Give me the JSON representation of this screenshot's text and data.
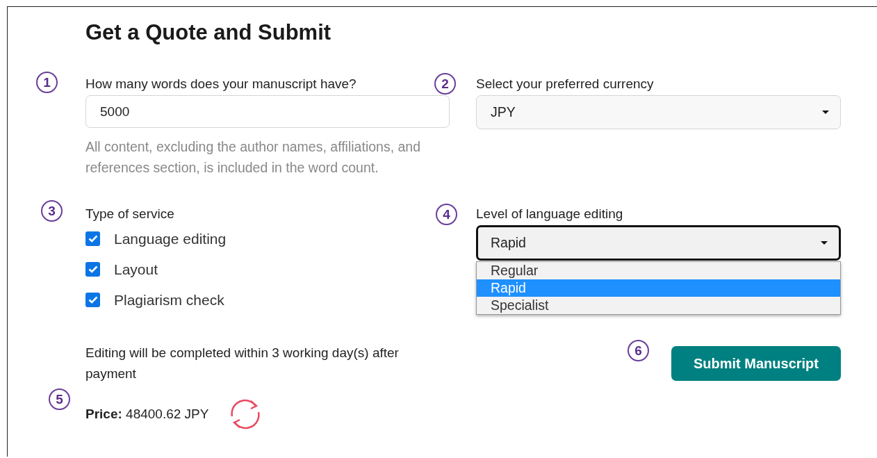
{
  "title": "Get a Quote and Submit",
  "word_count": {
    "marker": "1",
    "label": "How many words does your manuscript have?",
    "value": "5000",
    "help": "All content, excluding the author names, affiliations, and references section, is included in the word count."
  },
  "currency": {
    "marker": "2",
    "label": "Select your preferred currency",
    "value": "JPY"
  },
  "service": {
    "marker": "3",
    "label": "Type of service",
    "options": [
      {
        "label": "Language editing",
        "checked": true
      },
      {
        "label": "Layout",
        "checked": true
      },
      {
        "label": "Plagiarism check",
        "checked": true
      }
    ]
  },
  "editing_level": {
    "marker": "4",
    "label": "Level of language editing",
    "value": "Rapid",
    "expanded": true,
    "options": [
      {
        "label": "Regular",
        "selected": false
      },
      {
        "label": "Rapid",
        "selected": true
      },
      {
        "label": "Specialist",
        "selected": false
      }
    ]
  },
  "completion_note": "Editing will be completed within 3 working day(s) after payment",
  "price": {
    "marker": "5",
    "label": "Price:",
    "value": "48400.62 JPY"
  },
  "submit": {
    "marker": "6",
    "label": "Submit Manuscript"
  }
}
